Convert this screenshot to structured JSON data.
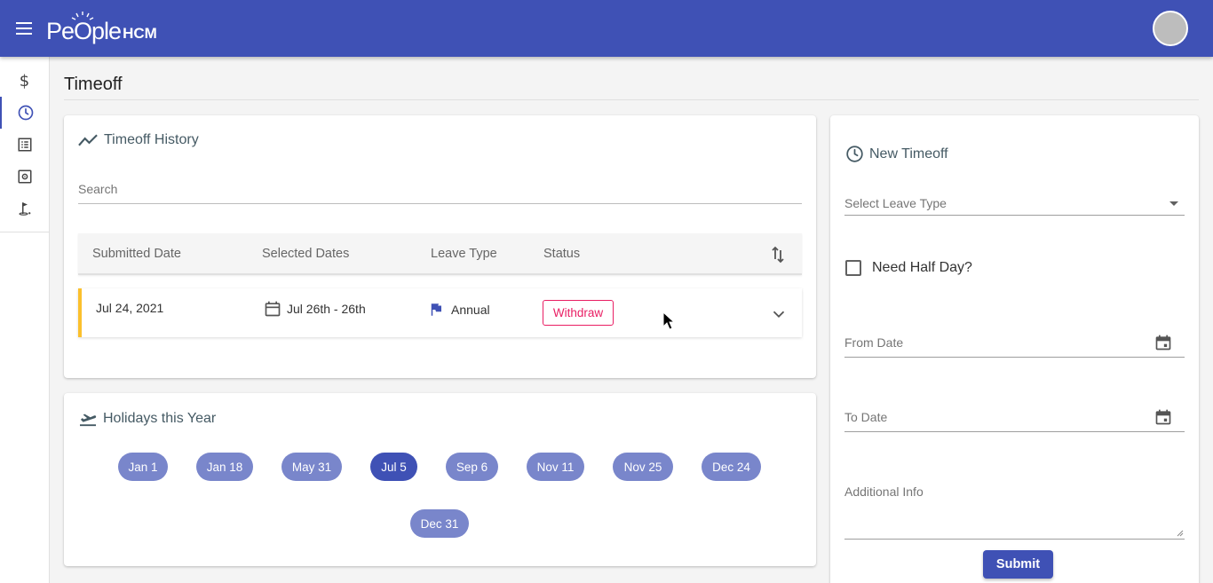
{
  "app": {
    "logo_word": "PeOple",
    "logo_suffix": "HCM"
  },
  "sidebar": {
    "items": [
      {
        "icon": "dollar-icon",
        "glyph": "$"
      },
      {
        "icon": "clock-icon"
      },
      {
        "icon": "list-icon"
      },
      {
        "icon": "settings-box-icon"
      },
      {
        "icon": "golf-icon"
      }
    ],
    "active_index": 1
  },
  "page": {
    "title": "Timeoff"
  },
  "history": {
    "title": "Timeoff History",
    "search_placeholder": "Search",
    "columns": [
      "Submitted Date",
      "Selected Dates",
      "Leave Type",
      "Status"
    ],
    "rows": [
      {
        "submitted": "Jul 24, 2021",
        "dates": "Jul 26th - 26th",
        "leave_type": "Annual",
        "status_action": "Withdraw",
        "accent": "#fbc02d"
      }
    ]
  },
  "holidays": {
    "title": "Holidays this Year",
    "dates": [
      "Jan 1",
      "Jan 18",
      "May 31",
      "Jul 5",
      "Sep 6",
      "Nov 11",
      "Nov 25",
      "Dec 24",
      "Dec 31"
    ],
    "selected": "Jul 5"
  },
  "new_timeoff": {
    "title": "New Timeoff",
    "leave_type_placeholder": "Select Leave Type",
    "half_day_label": "Need Half Day?",
    "half_day_checked": false,
    "from_date_label": "From Date",
    "to_date_label": "To Date",
    "additional_info_label": "Additional Info",
    "submit_label": "Submit"
  },
  "colors": {
    "primary": "#3f51b5",
    "chip": "#7986cb",
    "withdraw": "#e91e63",
    "pending_accent": "#fbc02d"
  }
}
